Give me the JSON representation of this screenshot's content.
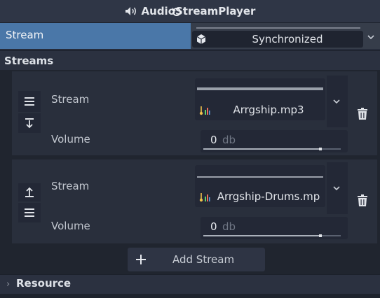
{
  "header": {
    "title": "AudioStreamPlayer",
    "icon": "speaker-icon"
  },
  "stream_property": {
    "label": "Stream",
    "revert_icon": "revert-icon",
    "value": "Synchronized",
    "value_icon": "cube-icon",
    "dropdown_icon": "chevron-down-icon"
  },
  "sections": {
    "streams": "Streams",
    "resource": "Resource"
  },
  "streams": [
    {
      "stream_label": "Stream",
      "file_name": "Arrgship.mp3",
      "volume_label": "Volume",
      "volume_value": "0",
      "volume_unit": "db",
      "volume_level": 0.85,
      "controls": [
        "menu-icon",
        "arrow-down-icon"
      ]
    },
    {
      "stream_label": "Stream",
      "file_name": "Arrgship-Drums.mp",
      "volume_label": "Volume",
      "volume_value": "0",
      "volume_unit": "db",
      "volume_level": 0.85,
      "controls": [
        "arrow-up-icon",
        "menu-icon"
      ]
    }
  ],
  "add_button": {
    "label": "Add Stream"
  },
  "colors": {
    "accent": "#4a77a8",
    "background": "#262c3b",
    "panel": "#292f3c",
    "field": "#232836"
  }
}
